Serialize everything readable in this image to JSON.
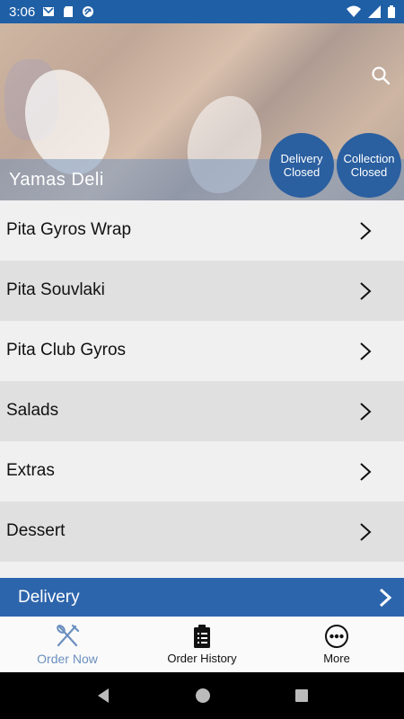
{
  "status_bar": {
    "time": "3:06"
  },
  "hero": {
    "title": "Yamas Deli"
  },
  "delivery_status": {
    "line1": "Delivery",
    "line2": "Closed"
  },
  "collection_status": {
    "line1": "Collection",
    "line2": "Closed"
  },
  "menu": {
    "items": [
      {
        "label": "Pita Gyros Wrap"
      },
      {
        "label": "Pita Souvlaki"
      },
      {
        "label": "Pita Club Gyros"
      },
      {
        "label": "Salads"
      },
      {
        "label": "Extras"
      },
      {
        "label": "Dessert"
      }
    ]
  },
  "delivery_bar": {
    "label": "Delivery"
  },
  "tabs": {
    "order_now": "Order Now",
    "order_history": "Order History",
    "more": "More"
  },
  "colors": {
    "primary": "#2d65ac",
    "status_bar": "#1f5fa6",
    "active_tab": "#6c90bf"
  }
}
